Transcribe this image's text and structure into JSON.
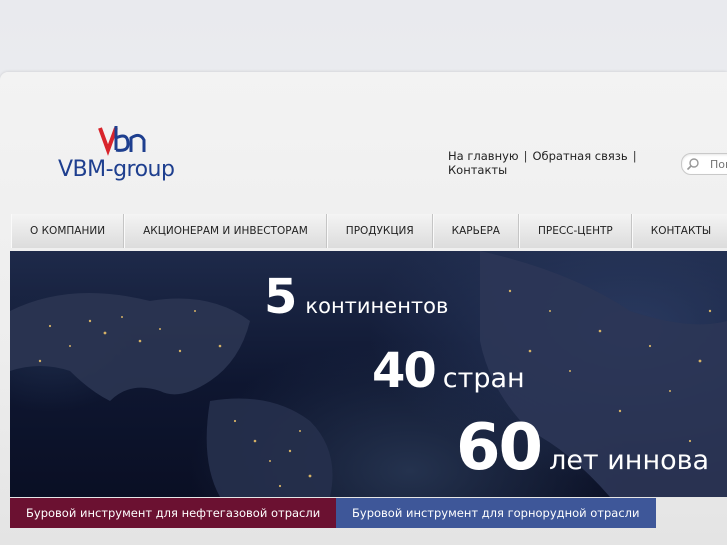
{
  "brand": {
    "logo_text": "VBM-group",
    "logo_mark_text": "vbm",
    "colors": {
      "primary": "#1e3f8f",
      "accent": "#d8242b"
    }
  },
  "header": {
    "links": [
      {
        "label": "На главную"
      },
      {
        "label": "Обратная связь"
      },
      {
        "label": "Контакты"
      }
    ],
    "separator": "|",
    "search": {
      "placeholder": "Поиск",
      "icon": "search-icon"
    }
  },
  "nav": {
    "items": [
      {
        "label": "О КОМПАНИИ"
      },
      {
        "label": "АКЦИОНЕРАМ И ИНВЕСТОРАМ"
      },
      {
        "label": "ПРОДУКЦИЯ"
      },
      {
        "label": "КАРЬЕРА"
      },
      {
        "label": "ПРЕСС-ЦЕНТР"
      },
      {
        "label": "КОНТАКТЫ"
      }
    ]
  },
  "banner": {
    "lines": [
      {
        "number": "5",
        "text": "континентов"
      },
      {
        "number": "40",
        "text": "стран"
      },
      {
        "number": "60",
        "text": "лет иннова"
      }
    ]
  },
  "tabs": {
    "items": [
      {
        "label": "Буровой инструмент для нефтегазовой отрасли",
        "color": "#6b1131"
      },
      {
        "label": "Буровой инструмент для горнорудной отрасли",
        "color": "#3e5799"
      }
    ]
  }
}
